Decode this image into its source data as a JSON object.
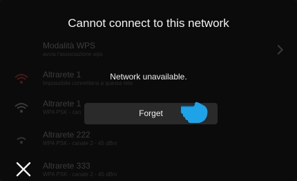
{
  "dialog": {
    "title": "Cannot connect to this network",
    "message": "Network unavailable.",
    "forget_label": "Forget"
  },
  "networks": [
    {
      "name": "Modalità WPS",
      "sub": "avvia l'associazione wps",
      "icon": "none"
    },
    {
      "name": "Altrarete 1",
      "sub": "Impossibile connettersi a questa rete",
      "icon": "wifi-error-icon"
    },
    {
      "name": "Altrarete 1",
      "sub": "WPA PSK - can",
      "icon": "wifi-icon"
    },
    {
      "name": "Altrarete 222",
      "sub": "WPA PSK - canale 2 - 45 dBm",
      "icon": "wifi-weak-icon"
    },
    {
      "name": "Altrarete 333",
      "sub": "WPA PSK - canale 2 - 45 dBm",
      "icon": "wifi-icon"
    }
  ],
  "colors": {
    "background": "#0b0b0b",
    "accent_hand": "#1fa3e8",
    "error_red": "#5a1a1a"
  }
}
